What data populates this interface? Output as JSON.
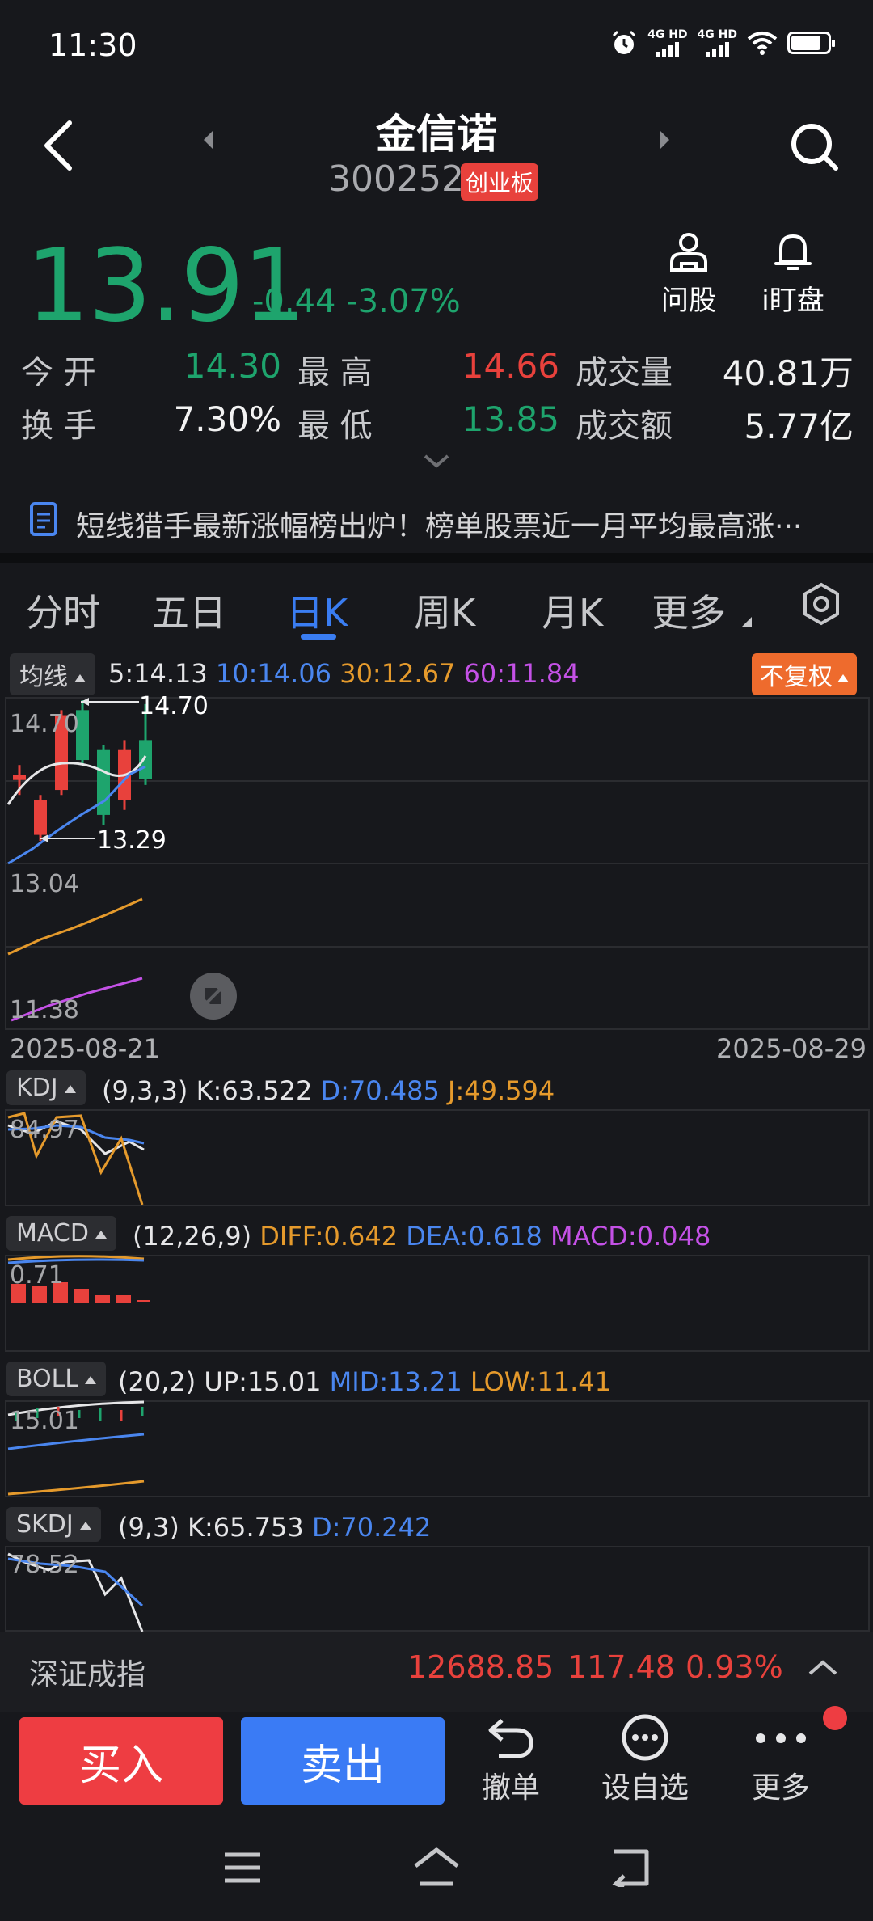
{
  "status_bar": {
    "time": "11:30",
    "net1": "4G HD",
    "net2": "4G HD"
  },
  "header": {
    "name": "金信诺",
    "code": "300252",
    "board": "创业板"
  },
  "quote": {
    "price": "13.91",
    "change": "-0.44",
    "change_pct": "-3.07%",
    "actions": {
      "ask": "问股",
      "watch": "i盯盘"
    },
    "open_label": "今  开",
    "open": "14.30",
    "high_label": "最  高",
    "high": "14.66",
    "volume_label": "成交量",
    "volume": "40.81万",
    "turnover_label": "换  手",
    "turnover": "7.30%",
    "low_label": "最  低",
    "low": "13.85",
    "amount_label": "成交额",
    "amount": "5.77亿"
  },
  "news": {
    "text": "短线猎手最新涨幅榜出炉！榜单股票近一月平均最高涨···"
  },
  "tabs": [
    "分时",
    "五日",
    "日K",
    "周K",
    "月K",
    "更多"
  ],
  "ma": {
    "label": "均线",
    "ma5": "5:14.13",
    "ma10": "10:14.06",
    "ma30": "30:12.67",
    "ma60": "60:11.84",
    "adjust": "不复权"
  },
  "kchart": {
    "max_label": "14.70",
    "max_arrow": "14.70",
    "min_arrow": "13.29",
    "axis_mid": "13.04",
    "axis_low": "11.38",
    "date_start": "2025-08-21",
    "date_end": "2025-08-29"
  },
  "chart_data": {
    "type": "candlestick",
    "x": [
      "2025-08-21",
      "2025-08-22",
      "2025-08-25",
      "2025-08-26",
      "2025-08-27",
      "2025-08-28",
      "2025-08-29"
    ],
    "open": [
      13.9,
      13.35,
      13.8,
      14.6,
      14.2,
      13.7,
      14.3
    ],
    "close": [
      13.95,
      13.7,
      14.55,
      14.1,
      13.55,
      14.2,
      13.91
    ],
    "high": [
      14.05,
      13.75,
      14.6,
      14.7,
      14.25,
      14.3,
      14.66
    ],
    "low": [
      13.75,
      13.29,
      13.75,
      14.05,
      13.45,
      13.6,
      13.85
    ]
  },
  "kdj": {
    "label": "KDJ",
    "params": "(9,3,3)",
    "k": "K:63.522",
    "d": "D:70.485",
    "j": "J:49.594",
    "axis": "84.97"
  },
  "macd": {
    "label": "MACD",
    "params": "(12,26,9)",
    "diff": "DIFF:0.642",
    "dea": "DEA:0.618",
    "macd": "MACD:0.048",
    "axis": "0.71"
  },
  "boll": {
    "label": "BOLL",
    "params": "(20,2)",
    "up": "UP:15.01",
    "mid": "MID:13.21",
    "low": "LOW:11.41",
    "axis": "15.01"
  },
  "skdj": {
    "label": "SKDJ",
    "params": "(9,3)",
    "k": "K:65.753",
    "d": "D:70.242",
    "axis": "78.52"
  },
  "index": {
    "name": "深证成指",
    "value": "12688.85",
    "change": "117.48",
    "pct": "0.93%"
  },
  "bottom": {
    "buy": "买入",
    "sell": "卖出",
    "cancel": "撤单",
    "watchlist": "设自选",
    "more": "更多"
  },
  "colors": {
    "up": "#e8413c",
    "down": "#1ea46d",
    "accent": "#3a7df2",
    "adjust": "#ee6b2d"
  }
}
